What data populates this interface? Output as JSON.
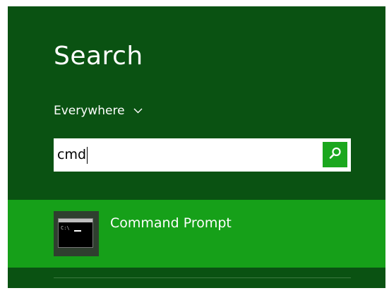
{
  "search": {
    "title": "Search",
    "scope_label": "Everywhere",
    "query": "cmd"
  },
  "icons": {
    "scope_chevron": "chevron-down-icon",
    "search_button": "magnifier-icon",
    "result_app": "command-prompt-icon"
  },
  "results": [
    {
      "label": "Command Prompt",
      "icon_text": "C:\\"
    }
  ],
  "colors": {
    "background": "#0a5212",
    "accent": "#1ba71e",
    "selected_row": "#16a019",
    "text": "#ffffff"
  }
}
